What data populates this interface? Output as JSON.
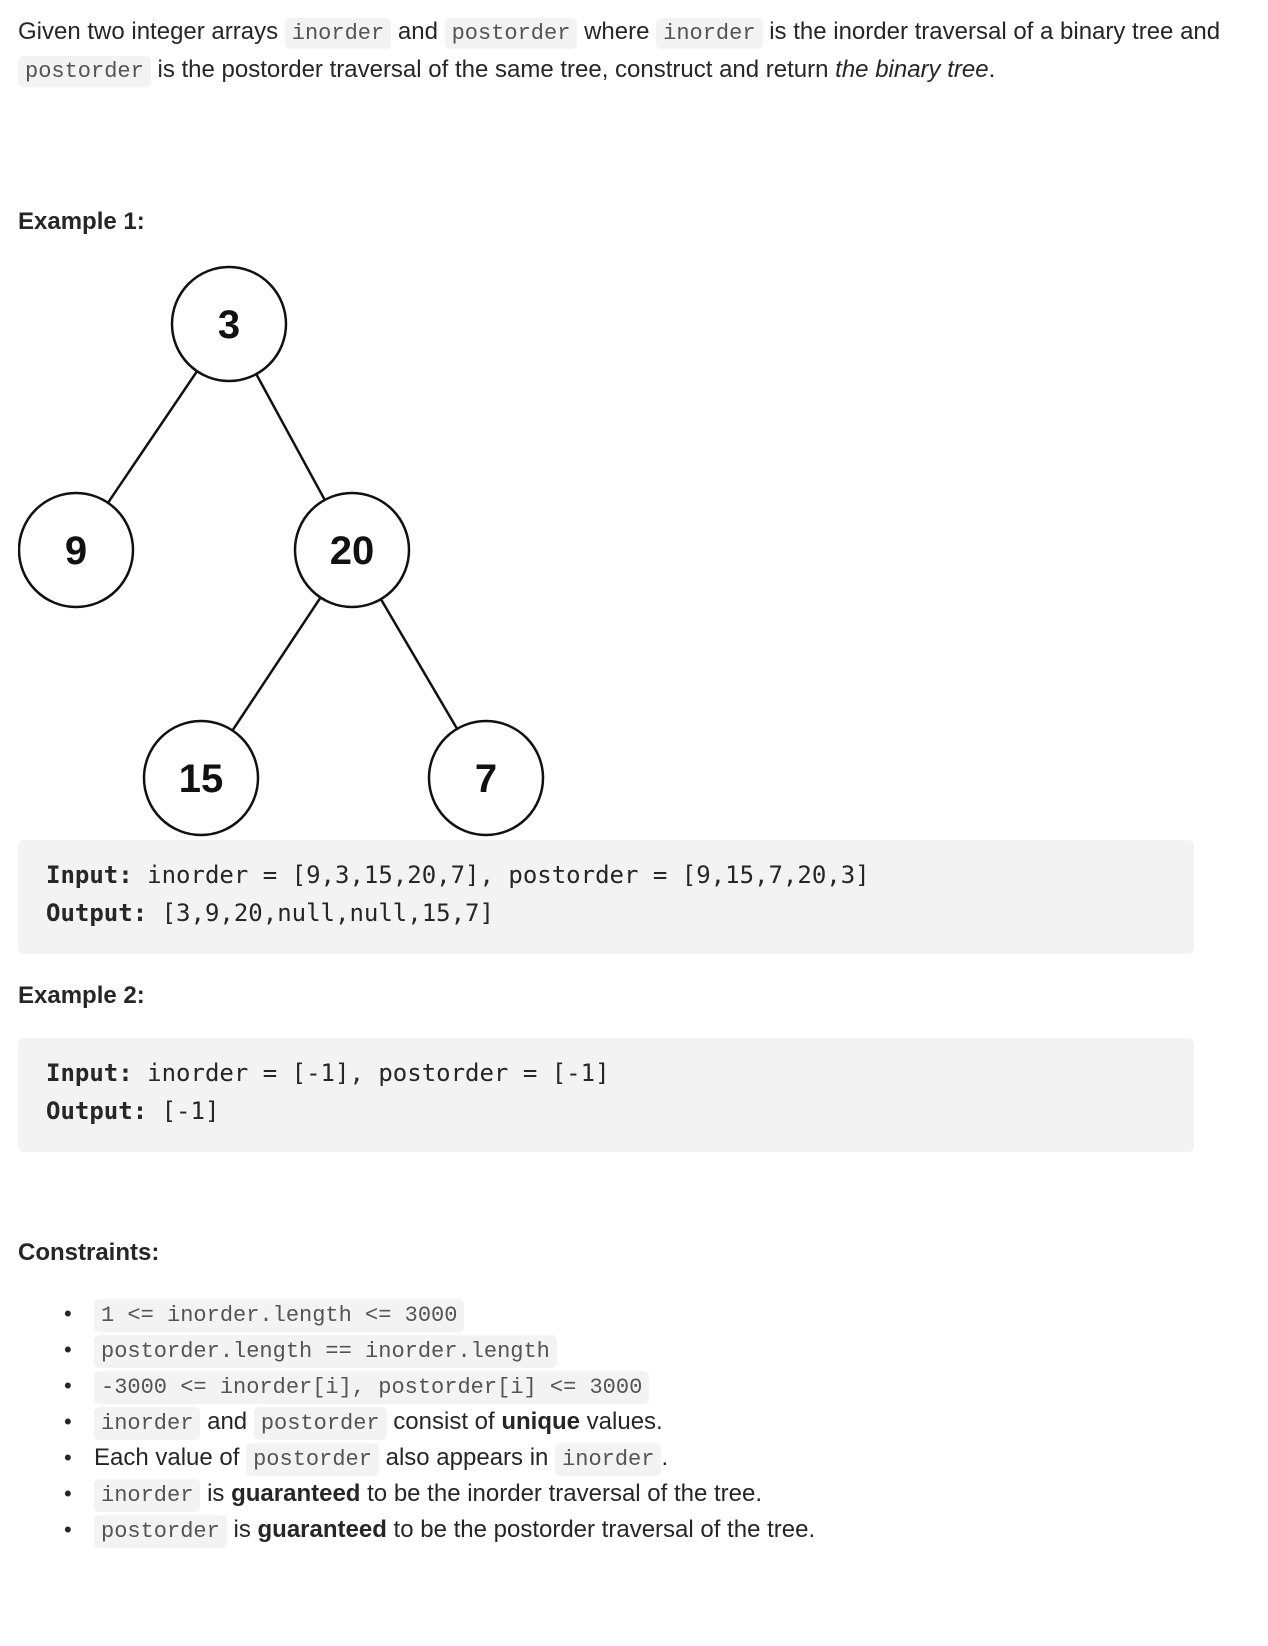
{
  "description": {
    "parts": [
      {
        "t": "text",
        "v": "Given two integer arrays "
      },
      {
        "t": "code",
        "v": "inorder"
      },
      {
        "t": "text",
        "v": " and "
      },
      {
        "t": "code",
        "v": "postorder"
      },
      {
        "t": "text",
        "v": " where "
      },
      {
        "t": "code",
        "v": "inorder"
      },
      {
        "t": "text",
        "v": " is the inorder traversal of a binary tree and "
      },
      {
        "t": "code",
        "v": "postorder"
      },
      {
        "t": "text",
        "v": " is the postorder traversal of the same tree, construct and return "
      },
      {
        "t": "em",
        "v": "the binary tree"
      },
      {
        "t": "text",
        "v": "."
      }
    ]
  },
  "examples": [
    {
      "heading": "Example 1:",
      "tree": {
        "nodes": [
          {
            "id": "n3",
            "label": "3"
          },
          {
            "id": "n9",
            "label": "9"
          },
          {
            "id": "n20",
            "label": "20"
          },
          {
            "id": "n15",
            "label": "15"
          },
          {
            "id": "n7",
            "label": "7"
          }
        ],
        "edges": [
          [
            "n3",
            "n9"
          ],
          [
            "n3",
            "n20"
          ],
          [
            "n20",
            "n15"
          ],
          [
            "n20",
            "n7"
          ]
        ]
      },
      "input_label": "Input:",
      "input_value": " inorder = [9,3,15,20,7], postorder = [9,15,7,20,3]",
      "output_label": "Output:",
      "output_value": " [3,9,20,null,null,15,7]"
    },
    {
      "heading": "Example 2:",
      "input_label": "Input:",
      "input_value": " inorder = [-1], postorder = [-1]",
      "output_label": "Output:",
      "output_value": " [-1]"
    }
  ],
  "constraints": {
    "heading": "Constraints:",
    "items": [
      [
        {
          "t": "code",
          "v": "1 <= inorder.length <= 3000"
        }
      ],
      [
        {
          "t": "code",
          "v": "postorder.length == inorder.length"
        }
      ],
      [
        {
          "t": "code",
          "v": "-3000 <= inorder[i], postorder[i] <= 3000"
        }
      ],
      [
        {
          "t": "code",
          "v": "inorder"
        },
        {
          "t": "text",
          "v": " and "
        },
        {
          "t": "code",
          "v": "postorder"
        },
        {
          "t": "text",
          "v": " consist of "
        },
        {
          "t": "b",
          "v": "unique"
        },
        {
          "t": "text",
          "v": " values."
        }
      ],
      [
        {
          "t": "text",
          "v": "Each value of "
        },
        {
          "t": "code",
          "v": "postorder"
        },
        {
          "t": "text",
          "v": " also appears in "
        },
        {
          "t": "code",
          "v": "inorder"
        },
        {
          "t": "text",
          "v": "."
        }
      ],
      [
        {
          "t": "code",
          "v": "inorder"
        },
        {
          "t": "text",
          "v": " is "
        },
        {
          "t": "b",
          "v": "guaranteed"
        },
        {
          "t": "text",
          "v": " to be the inorder traversal of the tree."
        }
      ],
      [
        {
          "t": "code",
          "v": "postorder"
        },
        {
          "t": "text",
          "v": " is "
        },
        {
          "t": "b",
          "v": "guaranteed"
        },
        {
          "t": "text",
          "v": " to be the postorder traversal of the tree."
        }
      ]
    ]
  }
}
